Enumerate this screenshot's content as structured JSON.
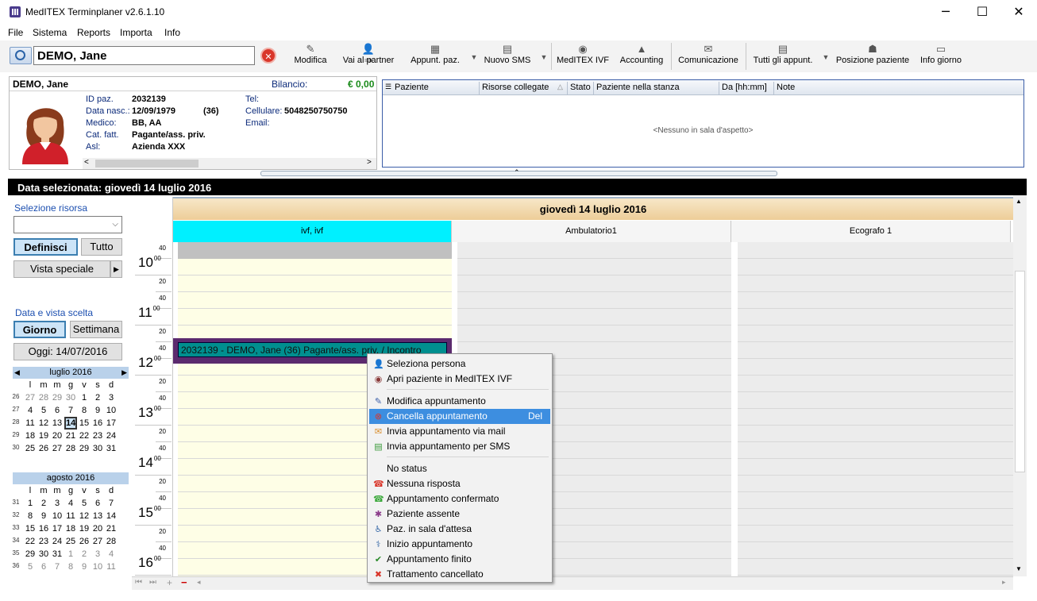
{
  "window": {
    "title": "MedITEX Terminplaner  v2.6.1.10",
    "min": "─",
    "max": "☐",
    "close": "✕"
  },
  "menu": [
    "File",
    "Sistema",
    "Reports",
    "Importa",
    "Info"
  ],
  "search": {
    "value": "DEMO, Jane"
  },
  "toolbar": [
    {
      "label": "Modifica",
      "icon": "edit-icon"
    },
    {
      "label": "Vai al partner",
      "icon": "partner-icon"
    },
    {
      "label": "Appunt. paz.",
      "icon": "appointments-icon"
    },
    {
      "label": "Nuovo SMS",
      "icon": "sms-icon"
    },
    {
      "label": "MedITEX IVF",
      "icon": "ivf-icon"
    },
    {
      "label": "Accounting",
      "icon": "accounting-icon"
    },
    {
      "label": "Comunicazione",
      "icon": "communication-icon"
    },
    {
      "label": "Tutti gli appunt.",
      "icon": "all-appointments-icon"
    },
    {
      "label": "Posizione paziente",
      "icon": "position-icon"
    },
    {
      "label": "Info giorno",
      "icon": "info-icon"
    }
  ],
  "patient": {
    "name": "DEMO, Jane",
    "balance_label": "Bilancio:",
    "balance": "€ 0,00",
    "id_label": "ID paz.",
    "id": "2032139",
    "dob_label": "Data nasc.:",
    "dob": "12/09/1979",
    "age": "(36)",
    "doctor_label": "Medico:",
    "doctor": "BB, AA",
    "cat_label": "Cat. fatt.",
    "cat": "Pagante/ass. priv.",
    "asl_label": "Asl:",
    "asl": "Azienda XXX",
    "tel_label": "Tel:",
    "tel": "",
    "cell_label": "Cellulare:",
    "cell": "5048250750750",
    "email_label": "Email:",
    "email": ""
  },
  "waiting": {
    "columns": [
      "Paziente",
      "Risorse collegate",
      "Stato",
      "Paziente nella stanza",
      "Da [hh:mm]",
      "Note"
    ],
    "empty": "<Nessuno in sala d'aspetto>"
  },
  "selected_date_bar": "Data selezionata:  giovedì 14 luglio 2016",
  "left": {
    "resource_label": "Selezione risorsa",
    "definisci": "Definisci",
    "tutto": "Tutto",
    "vista_speciale": "Vista speciale",
    "date_label": "Data e vista scelta",
    "giorno": "Giorno",
    "settimana": "Settimana",
    "oggi": "Oggi: 14/07/2016",
    "cal1": {
      "title": "luglio 2016",
      "days": [
        "l",
        "m",
        "m",
        "g",
        "v",
        "s",
        "d"
      ],
      "rows": [
        {
          "wk": "26",
          "d": [
            "27",
            "28",
            "29",
            "30",
            "1",
            "2",
            "3"
          ]
        },
        {
          "wk": "27",
          "d": [
            "4",
            "5",
            "6",
            "7",
            "8",
            "9",
            "10"
          ]
        },
        {
          "wk": "28",
          "d": [
            "11",
            "12",
            "13",
            "14",
            "15",
            "16",
            "17"
          ]
        },
        {
          "wk": "29",
          "d": [
            "18",
            "19",
            "20",
            "21",
            "22",
            "23",
            "24"
          ]
        },
        {
          "wk": "30",
          "d": [
            "25",
            "26",
            "27",
            "28",
            "29",
            "30",
            "31"
          ]
        }
      ]
    },
    "cal2": {
      "title": "agosto 2016",
      "days": [
        "l",
        "m",
        "m",
        "g",
        "v",
        "s",
        "d"
      ],
      "rows": [
        {
          "wk": "31",
          "d": [
            "1",
            "2",
            "3",
            "4",
            "5",
            "6",
            "7"
          ]
        },
        {
          "wk": "32",
          "d": [
            "8",
            "9",
            "10",
            "11",
            "12",
            "13",
            "14"
          ]
        },
        {
          "wk": "33",
          "d": [
            "15",
            "16",
            "17",
            "18",
            "19",
            "20",
            "21"
          ]
        },
        {
          "wk": "34",
          "d": [
            "22",
            "23",
            "24",
            "25",
            "26",
            "27",
            "28"
          ]
        },
        {
          "wk": "35",
          "d": [
            "29",
            "30",
            "31",
            "1",
            "2",
            "3",
            "4"
          ]
        },
        {
          "wk": "36",
          "d": [
            "5",
            "6",
            "7",
            "8",
            "9",
            "10",
            "11"
          ]
        }
      ]
    }
  },
  "schedule": {
    "day_header": "giovedì 14 luglio 2016",
    "resources": [
      "ivf, ivf",
      "Ambulatorio1",
      "Ecografo 1"
    ],
    "appointment": "2032139 - DEMO, Jane (36) Pagante/ass. priv. / Incontro",
    "times": [
      {
        "h": "",
        "m": "40"
      },
      {
        "h": "10",
        "m": "00"
      },
      {
        "h": "",
        "m": "20"
      },
      {
        "h": "",
        "m": "40"
      },
      {
        "h": "11",
        "m": "00"
      },
      {
        "h": "",
        "m": "20"
      },
      {
        "h": "",
        "m": "40"
      },
      {
        "h": "12",
        "m": "00"
      },
      {
        "h": "",
        "m": "20"
      },
      {
        "h": "",
        "m": "40"
      },
      {
        "h": "13",
        "m": "00"
      },
      {
        "h": "",
        "m": "20"
      },
      {
        "h": "",
        "m": "40"
      },
      {
        "h": "14",
        "m": "00"
      },
      {
        "h": "",
        "m": "20"
      },
      {
        "h": "",
        "m": "40"
      },
      {
        "h": "15",
        "m": "00"
      },
      {
        "h": "",
        "m": "20"
      },
      {
        "h": "",
        "m": "40"
      },
      {
        "h": "16",
        "m": "00"
      }
    ]
  },
  "context_menu": [
    {
      "label": "Seleziona persona",
      "icon": "person-icon",
      "color": "#4a7fc1"
    },
    {
      "label": "Apri paziente in MedITEX IVF",
      "icon": "ivf-icon",
      "color": "#8a3a3a"
    },
    {
      "sep": true
    },
    {
      "label": "Modifica appuntamento",
      "icon": "edit-icon",
      "color": "#3a5da8"
    },
    {
      "label": "Cancella appuntamento",
      "shortcut": "Del",
      "icon": "cancel-icon",
      "color": "#d9362a",
      "highlight": true
    },
    {
      "label": "Invia appuntamento via mail",
      "icon": "mail-icon",
      "color": "#d98c2a"
    },
    {
      "label": "Invia appuntamento per SMS",
      "icon": "sms-icon",
      "color": "#3a9a3a"
    },
    {
      "sep": true
    },
    {
      "label": "No status",
      "icon": "none",
      "color": ""
    },
    {
      "label": "Nessuna risposta",
      "icon": "phone-red-icon",
      "color": "#d9362a"
    },
    {
      "label": "Appuntamento confermato",
      "icon": "phone-green-icon",
      "color": "#3aa83a"
    },
    {
      "label": "Paziente assente",
      "icon": "absent-icon",
      "color": "#8a3a8a"
    },
    {
      "label": "Paz. in sala d'attesa",
      "icon": "waiting-icon",
      "color": "#3a6aa8"
    },
    {
      "label": "Inizio appuntamento",
      "icon": "stethoscope-icon",
      "color": "#3a6aa8"
    },
    {
      "label": "Appuntamento finito",
      "icon": "check-icon",
      "color": "#2a8a2a"
    },
    {
      "label": "Trattamento cancellato",
      "icon": "x-icon",
      "color": "#d9362a"
    }
  ]
}
